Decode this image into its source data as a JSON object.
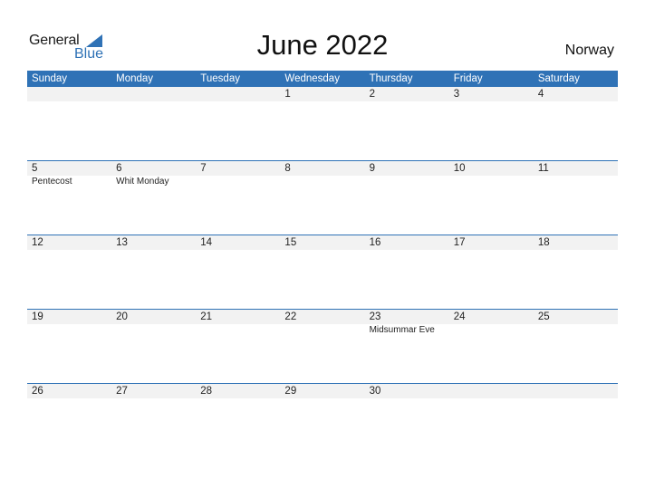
{
  "logo": {
    "general": "General",
    "blue": "Blue"
  },
  "title": "June 2022",
  "country": "Norway",
  "weekdays": [
    "Sunday",
    "Monday",
    "Tuesday",
    "Wednesday",
    "Thursday",
    "Friday",
    "Saturday"
  ],
  "weeks": [
    {
      "days": [
        "",
        "",
        "",
        "1",
        "2",
        "3",
        "4"
      ],
      "events": [
        "",
        "",
        "",
        "",
        "",
        "",
        ""
      ]
    },
    {
      "days": [
        "5",
        "6",
        "7",
        "8",
        "9",
        "10",
        "11"
      ],
      "events": [
        "Pentecost",
        "Whit Monday",
        "",
        "",
        "",
        "",
        ""
      ]
    },
    {
      "days": [
        "12",
        "13",
        "14",
        "15",
        "16",
        "17",
        "18"
      ],
      "events": [
        "",
        "",
        "",
        "",
        "",
        "",
        ""
      ]
    },
    {
      "days": [
        "19",
        "20",
        "21",
        "22",
        "23",
        "24",
        "25"
      ],
      "events": [
        "",
        "",
        "",
        "",
        "Midsummar Eve",
        "",
        ""
      ]
    },
    {
      "days": [
        "26",
        "27",
        "28",
        "29",
        "30",
        "",
        ""
      ],
      "events": [
        "",
        "",
        "",
        "",
        "",
        "",
        ""
      ]
    }
  ],
  "colors": {
    "accent": "#2f72b6",
    "day_row_bg": "#f2f2f2"
  }
}
